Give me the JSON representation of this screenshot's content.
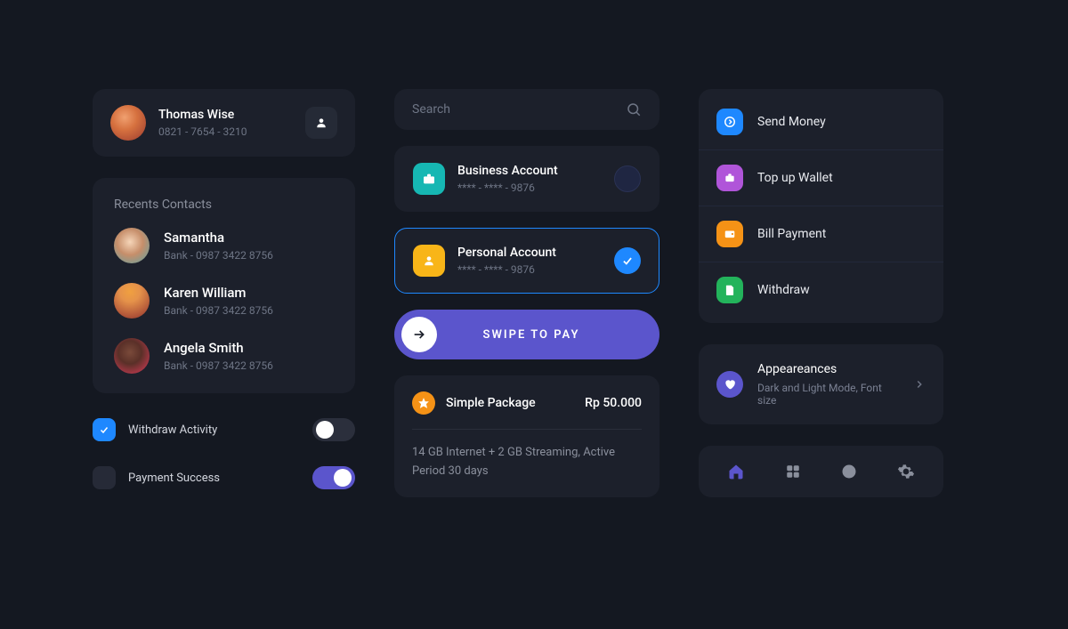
{
  "profile": {
    "name": "Thomas Wise",
    "phone": "0821 - 7654 - 3210"
  },
  "recents": {
    "title": "Recents Contacts",
    "contacts": [
      {
        "name": "Samantha",
        "detail": "Bank - 0987 3422 8756"
      },
      {
        "name": "Karen William",
        "detail": "Bank - 0987 3422 8756"
      },
      {
        "name": "Angela Smith",
        "detail": "Bank - 0987 3422 8756"
      }
    ]
  },
  "toggles": {
    "withdraw": {
      "label": "Withdraw Activity",
      "checked": true,
      "switch": false
    },
    "payment": {
      "label": "Payment Success",
      "checked": false,
      "switch": true
    }
  },
  "search": {
    "placeholder": "Search"
  },
  "accounts": [
    {
      "name": "Business Account",
      "masked": "**** - **** - 9876",
      "selected": false,
      "icon_color": "#16b7b3"
    },
    {
      "name": "Personal Account",
      "masked": "**** - **** - 9876",
      "selected": true,
      "icon_color": "#f8b518"
    }
  ],
  "swipe": {
    "label": "SWIPE TO PAY"
  },
  "package": {
    "name": "Simple Package",
    "price": "Rp 50.000",
    "description": "14 GB Internet + 2 GB Streaming, Active Period 30 days"
  },
  "menu": [
    {
      "label": "Send Money",
      "color": "#1e88ff",
      "icon": "send"
    },
    {
      "label": "Top up Wallet",
      "color": "#b055d9",
      "icon": "wallet"
    },
    {
      "label": "Bill Payment",
      "color": "#f59216",
      "icon": "bill"
    },
    {
      "label": "Withdraw",
      "color": "#23b35b",
      "icon": "withdraw"
    }
  ],
  "appearances": {
    "title": "Appeareances",
    "subtitle": "Dark and Light Mode, Font size"
  },
  "colors": {
    "accent": "#5b55cc",
    "blue": "#1e88ff"
  }
}
